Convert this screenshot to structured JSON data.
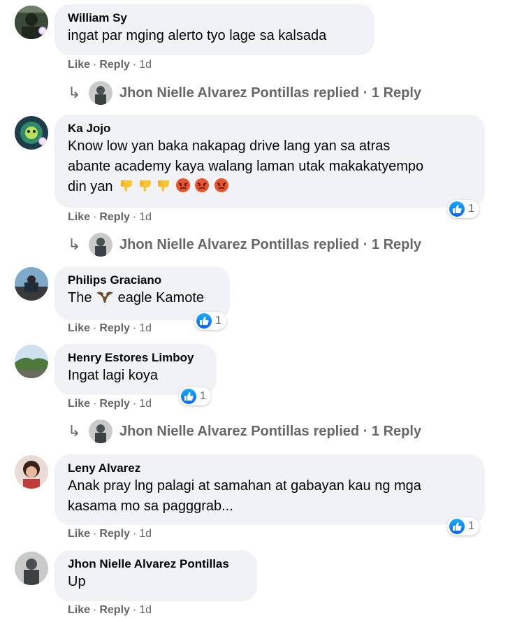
{
  "actions": {
    "like": "Like",
    "reply": "Reply",
    "separator": "·",
    "time": "1d"
  },
  "comments": [
    {
      "author": "William Sy",
      "text": "ingat par mging alerto tyo lage sa kalsada",
      "replies": {
        "name": "Jhon Nielle Alvarez Pontillas",
        "label": "replied · 1 Reply"
      }
    },
    {
      "author": "Ka Jojo",
      "line1": "Know low yan baka nakapag drive lang yan sa atras",
      "line2": "abante academy kaya walang laman utak makakatyempo",
      "line3": "din yan",
      "reaction_count": "1",
      "replies": {
        "name": "Jhon Nielle Alvarez Pontillas",
        "label": "replied · 1 Reply"
      }
    },
    {
      "author": "Philips Graciano",
      "text_before": "The",
      "text_after": "eagle Kamote",
      "reaction_count": "1"
    },
    {
      "author": "Henry Estores Limboy",
      "text": "Ingat lagi koya",
      "reaction_count": "1",
      "replies": {
        "name": "Jhon Nielle Alvarez Pontillas",
        "label": "replied · 1 Reply"
      }
    },
    {
      "author": "Leny Alvarez",
      "line1": "Anak pray lng palagi at samahan at gabayan kau ng mga",
      "line2": "kasama mo sa pagggrab...",
      "reaction_count": "1"
    },
    {
      "author": "Jhon Nielle Alvarez Pontillas",
      "text": "Up"
    }
  ],
  "colors": {
    "bubble": "#f0f2f5",
    "secondary_text": "#65676b",
    "like_blue": "#0866ff"
  },
  "icons": [
    "reply-arrow-icon",
    "like-reaction-icon",
    "thumbs-down-emoji",
    "angry-face-emoji",
    "eagle-emoji"
  ]
}
